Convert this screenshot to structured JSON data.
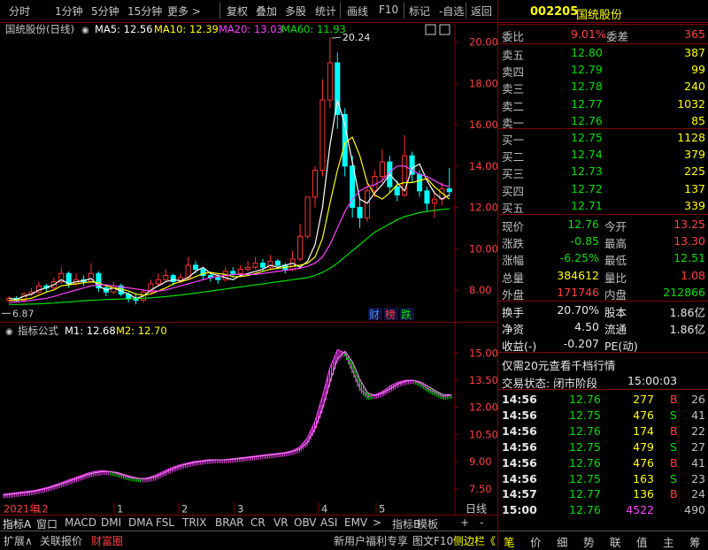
{
  "toolbar": {
    "left_items": [
      "分时",
      "1分钟",
      "5分钟",
      "15分钟",
      "更多 >"
    ],
    "right_items": [
      "复权",
      "叠加",
      "多股",
      "统计",
      "画线",
      "F10",
      "标记",
      "-自选",
      "返回"
    ]
  },
  "main_chart": {
    "stock_label": "国统股份(日线)",
    "ma5_label": "MA5: 12.56",
    "ma10_label": "MA10: 12.39",
    "ma20_label": "MA20: 13.03",
    "ma60_label": "MA60: 11.93",
    "high_annotation": "20.24",
    "low_annotation": "6.87",
    "badges": [
      "财",
      "榜",
      "跌"
    ],
    "colors": {
      "ma5": "#ffffff",
      "ma10": "#ffff00",
      "ma20": "#ff40ff",
      "ma60": "#00e000",
      "up": "#ff3232",
      "down": "#00ffff",
      "axis": "#800000",
      "label": "#ff4040"
    }
  },
  "sub_chart": {
    "title": "指标公式",
    "m1_label": "M1: 12.68",
    "m2_label": "M2: 12.70"
  },
  "x_axis": {
    "labels": [
      {
        "text": "2021年",
        "color": "#ff4040"
      },
      {
        "text": "12",
        "color": "#ff4040"
      },
      {
        "text": "1",
        "color": "#c8c8c8"
      },
      {
        "text": "2",
        "color": "#c8c8c8"
      },
      {
        "text": "3",
        "color": "#c8c8c8"
      },
      {
        "text": "4",
        "color": "#c8c8c8"
      },
      {
        "text": "5",
        "color": "#c8c8c8"
      }
    ],
    "period_label": "日线"
  },
  "chart_data": [
    {
      "type": "line",
      "title": "国统股份(日线)",
      "ylim": [
        6.5,
        20.8
      ],
      "yticks": [
        "8.00",
        "10.00",
        "12.00",
        "14.00",
        "16.00",
        "18.00",
        "20.00"
      ],
      "series": [
        {
          "name": "MA5",
          "color": "#ffffff",
          "values": [
            7.6,
            7.55,
            7.7,
            7.8,
            8.0,
            8.1,
            8.25,
            8.5,
            8.3,
            8.4,
            8.45,
            8.55,
            8.2,
            8.0,
            8.1,
            7.95,
            7.8,
            7.6,
            7.7,
            8.0,
            8.2,
            8.4,
            8.5,
            8.45,
            8.6,
            8.9,
            9.1,
            8.8,
            8.7,
            8.6,
            8.5,
            8.7,
            8.8,
            8.9,
            9.0,
            9.2,
            9.1,
            9.2,
            9.3,
            9.1,
            9.4,
            10.2,
            12.0,
            15.0,
            17.2,
            16.0,
            14.2,
            12.4,
            12.2,
            12.7,
            13.1,
            13.6,
            13.2,
            12.8,
            13.9,
            14.1,
            13.3,
            12.7,
            12.4,
            12.6
          ]
        },
        {
          "name": "MA10",
          "color": "#ffff00",
          "values": [
            7.5,
            7.5,
            7.55,
            7.6,
            7.75,
            7.9,
            8.0,
            8.2,
            8.25,
            8.3,
            8.35,
            8.4,
            8.35,
            8.2,
            8.1,
            8.05,
            7.95,
            7.8,
            7.75,
            7.8,
            7.95,
            8.1,
            8.3,
            8.4,
            8.5,
            8.65,
            8.8,
            8.85,
            8.8,
            8.75,
            8.65,
            8.65,
            8.7,
            8.8,
            8.9,
            9.0,
            9.05,
            9.1,
            9.15,
            9.2,
            9.3,
            9.6,
            10.5,
            12.2,
            13.8,
            15.1,
            15.4,
            14.5,
            13.2,
            12.6,
            12.4,
            12.7,
            13.1,
            13.2,
            13.2,
            13.3,
            13.4,
            13.0,
            12.7,
            12.4
          ]
        },
        {
          "name": "MA20",
          "color": "#ff40ff",
          "values": [
            7.4,
            7.42,
            7.45,
            7.5,
            7.55,
            7.6,
            7.68,
            7.8,
            7.9,
            8.0,
            8.1,
            8.2,
            8.25,
            8.25,
            8.2,
            8.15,
            8.1,
            8.05,
            8.0,
            7.95,
            7.95,
            8.0,
            8.1,
            8.2,
            8.3,
            8.4,
            8.5,
            8.6,
            8.65,
            8.7,
            8.75,
            8.75,
            8.75,
            8.75,
            8.8,
            8.85,
            8.9,
            8.95,
            9.0,
            9.05,
            9.15,
            9.3,
            9.6,
            10.2,
            11.0,
            11.8,
            12.4,
            12.8,
            13.0,
            13.1,
            13.3,
            13.7,
            14.0,
            14.0,
            13.8,
            13.6,
            13.5,
            13.3,
            13.1,
            13.0
          ]
        },
        {
          "name": "MA60",
          "color": "#00e000",
          "values": [
            7.3,
            7.3,
            7.31,
            7.32,
            7.33,
            7.35,
            7.37,
            7.4,
            7.42,
            7.45,
            7.48,
            7.5,
            7.52,
            7.54,
            7.55,
            7.56,
            7.57,
            7.58,
            7.6,
            7.62,
            7.65,
            7.68,
            7.72,
            7.76,
            7.8,
            7.85,
            7.9,
            7.95,
            8.0,
            8.05,
            8.1,
            8.15,
            8.2,
            8.25,
            8.3,
            8.35,
            8.4,
            8.45,
            8.5,
            8.55,
            8.6,
            8.7,
            8.85,
            9.05,
            9.3,
            9.6,
            9.9,
            10.2,
            10.5,
            10.8,
            11.0,
            11.2,
            11.4,
            11.55,
            11.65,
            11.75,
            11.8,
            11.85,
            11.9,
            11.93
          ]
        }
      ],
      "candles": [
        [
          7.5,
          7.6,
          7.7,
          7.4
        ],
        [
          7.6,
          7.5,
          7.7,
          7.4
        ],
        [
          7.5,
          7.8,
          7.9,
          7.4
        ],
        [
          7.8,
          7.9,
          8.1,
          7.7
        ],
        [
          7.9,
          8.2,
          8.4,
          7.8
        ],
        [
          8.2,
          8.1,
          8.3,
          7.9
        ],
        [
          8.1,
          8.4,
          8.6,
          8.0
        ],
        [
          8.4,
          8.8,
          9.1,
          8.3
        ],
        [
          8.8,
          8.3,
          8.9,
          8.1
        ],
        [
          8.3,
          8.5,
          8.8,
          8.2
        ],
        [
          8.5,
          8.4,
          8.7,
          8.2
        ],
        [
          8.4,
          8.8,
          9.3,
          8.3
        ],
        [
          8.8,
          8.1,
          8.9,
          7.9
        ],
        [
          8.1,
          7.9,
          8.2,
          7.7
        ],
        [
          7.9,
          8.2,
          8.4,
          7.8
        ],
        [
          8.2,
          7.8,
          8.3,
          7.7
        ],
        [
          7.8,
          7.6,
          7.9,
          7.4
        ],
        [
          7.6,
          7.5,
          7.8,
          7.3
        ],
        [
          7.5,
          7.9,
          8.0,
          7.4
        ],
        [
          7.9,
          8.3,
          8.5,
          7.8
        ],
        [
          8.3,
          8.5,
          8.8,
          8.2
        ],
        [
          8.5,
          8.7,
          9.0,
          8.4
        ],
        [
          8.7,
          8.4,
          8.8,
          8.2
        ],
        [
          8.4,
          8.6,
          8.8,
          8.3
        ],
        [
          8.6,
          9.2,
          9.6,
          8.5
        ],
        [
          9.2,
          9.0,
          9.4,
          8.8
        ],
        [
          9.0,
          8.7,
          9.1,
          8.5
        ],
        [
          8.7,
          8.6,
          8.9,
          8.4
        ],
        [
          8.6,
          8.5,
          8.8,
          8.3
        ],
        [
          8.5,
          8.9,
          9.1,
          8.4
        ],
        [
          8.9,
          8.8,
          9.1,
          8.6
        ],
        [
          8.8,
          9.0,
          9.2,
          8.7
        ],
        [
          9.0,
          9.1,
          9.4,
          8.9
        ],
        [
          9.1,
          9.3,
          9.6,
          9.0
        ],
        [
          9.3,
          9.1,
          9.5,
          8.9
        ],
        [
          9.1,
          9.4,
          9.7,
          9.0
        ],
        [
          9.4,
          9.2,
          9.5,
          9.0
        ],
        [
          9.2,
          9.0,
          9.3,
          8.8
        ],
        [
          9.0,
          9.5,
          9.9,
          8.9
        ],
        [
          9.5,
          10.6,
          11.2,
          9.4
        ],
        [
          10.6,
          12.5,
          12.5,
          10.5
        ],
        [
          12.5,
          13.8,
          14.0,
          12.0
        ],
        [
          13.8,
          17.2,
          18.2,
          13.5
        ],
        [
          17.2,
          19.0,
          20.24,
          16.8
        ],
        [
          19.0,
          16.5,
          19.5,
          15.8
        ],
        [
          16.5,
          14.0,
          16.8,
          13.5
        ],
        [
          14.0,
          12.0,
          14.5,
          11.5
        ],
        [
          12.0,
          11.5,
          12.5,
          11.0
        ],
        [
          11.5,
          12.8,
          13.2,
          11.3
        ],
        [
          12.8,
          13.5,
          13.8,
          12.5
        ],
        [
          13.5,
          14.2,
          14.8,
          13.2
        ],
        [
          14.2,
          13.0,
          14.5,
          12.7
        ],
        [
          13.0,
          12.6,
          13.3,
          12.3
        ],
        [
          12.6,
          14.5,
          15.5,
          12.5
        ],
        [
          14.5,
          13.6,
          14.7,
          13.2
        ],
        [
          13.6,
          12.8,
          13.8,
          12.5
        ],
        [
          12.8,
          12.2,
          13.0,
          11.8
        ],
        [
          12.2,
          12.4,
          12.8,
          11.5
        ],
        [
          12.4,
          12.9,
          13.2,
          12.1
        ],
        [
          12.9,
          12.76,
          13.9,
          12.51
        ]
      ]
    },
    {
      "type": "area",
      "title": "指标公式",
      "ylim": [
        7.0,
        15.8
      ],
      "yticks": [
        "7.50",
        "9.00",
        "10.50",
        "12.00",
        "13.50",
        "15.00"
      ],
      "series": [
        {
          "name": "M1",
          "values": [
            7.2,
            7.25,
            7.3,
            7.35,
            7.4,
            7.5,
            7.6,
            7.75,
            7.9,
            8.05,
            8.2,
            8.35,
            8.45,
            8.5,
            8.45,
            8.35,
            8.2,
            8.1,
            8.05,
            8.1,
            8.25,
            8.45,
            8.65,
            8.8,
            8.9,
            9.0,
            9.05,
            9.1,
            9.1,
            9.1,
            9.15,
            9.2,
            9.25,
            9.3,
            9.35,
            9.4,
            9.45,
            9.5,
            9.6,
            9.8,
            10.3,
            11.2,
            12.6,
            14.2,
            15.2,
            15.0,
            14.0,
            13.0,
            12.6,
            12.7,
            12.9,
            13.2,
            13.4,
            13.5,
            13.5,
            13.3,
            13.0,
            12.8,
            12.6,
            12.68
          ]
        },
        {
          "name": "M2",
          "values": [
            7.15,
            7.2,
            7.26,
            7.3,
            7.36,
            7.45,
            7.55,
            7.68,
            7.82,
            7.97,
            8.12,
            8.27,
            8.38,
            8.45,
            8.45,
            8.4,
            8.27,
            8.15,
            8.06,
            8.06,
            8.16,
            8.35,
            8.55,
            8.72,
            8.85,
            8.95,
            9.02,
            9.07,
            9.1,
            9.1,
            9.12,
            9.17,
            9.22,
            9.27,
            9.32,
            9.37,
            9.42,
            9.47,
            9.55,
            9.7,
            10.05,
            10.8,
            11.9,
            13.4,
            14.7,
            15.1,
            14.5,
            13.5,
            12.8,
            12.65,
            12.8,
            13.05,
            13.3,
            13.45,
            13.5,
            13.4,
            13.15,
            12.9,
            12.7,
            12.7
          ]
        }
      ]
    }
  ],
  "quote": {
    "code": "002205",
    "name": "国统股份",
    "weibi_label": "委比",
    "weibi_value": "9.01%",
    "weicha_label": "委差",
    "weicha_value": "365",
    "sell": [
      {
        "label": "卖五",
        "price": "12.80",
        "vol": "387"
      },
      {
        "label": "卖四",
        "price": "12.79",
        "vol": "99"
      },
      {
        "label": "卖三",
        "price": "12.78",
        "vol": "240"
      },
      {
        "label": "卖二",
        "price": "12.77",
        "vol": "1032"
      },
      {
        "label": "卖一",
        "price": "12.76",
        "vol": "85"
      }
    ],
    "buy": [
      {
        "label": "买一",
        "price": "12.75",
        "vol": "1128"
      },
      {
        "label": "买二",
        "price": "12.74",
        "vol": "379"
      },
      {
        "label": "买三",
        "price": "12.73",
        "vol": "225"
      },
      {
        "label": "买四",
        "price": "12.72",
        "vol": "137"
      },
      {
        "label": "买五",
        "price": "12.71",
        "vol": "339"
      }
    ],
    "stats": [
      {
        "l1": "现价",
        "v1": "12.76",
        "c1": "green",
        "l2": "今开",
        "v2": "13.25",
        "c2": "red"
      },
      {
        "l1": "涨跌",
        "v1": "-0.85",
        "c1": "green",
        "l2": "最高",
        "v2": "13.30",
        "c2": "red"
      },
      {
        "l1": "涨幅",
        "v1": "-6.25%",
        "c1": "green",
        "l2": "最低",
        "v2": "12.51",
        "c2": "green"
      },
      {
        "l1": "总量",
        "v1": "384612",
        "c1": "yellow",
        "l2": "量比",
        "v2": "1.08",
        "c2": "red"
      },
      {
        "l1": "外盘",
        "v1": "171746",
        "c1": "red",
        "l2": "内盘",
        "v2": "212866",
        "c2": "green"
      }
    ],
    "stats2": [
      {
        "l1": "换手",
        "v1": "20.70%",
        "l2": "股本",
        "v2": "1.86亿"
      },
      {
        "l1": "净资",
        "v1": "4.50",
        "l2": "流通",
        "v2": "1.86亿"
      },
      {
        "l1": "收益(-)",
        "v1": "-0.207",
        "l2": "PE(动)",
        "v2": ""
      }
    ],
    "promo": "仅需20元查看千档行情",
    "status_label": "交易状态: 闭市阶段",
    "status_time": "15:00:03"
  },
  "ticks": [
    {
      "time": "14:56",
      "price": "12.76",
      "vol": "277",
      "bs": "B",
      "n": "26"
    },
    {
      "time": "14:56",
      "price": "12.75",
      "vol": "476",
      "bs": "S",
      "n": "41"
    },
    {
      "time": "14:56",
      "price": "12.76",
      "vol": "174",
      "bs": "B",
      "n": "22"
    },
    {
      "time": "14:56",
      "price": "12.75",
      "vol": "479",
      "bs": "S",
      "n": "27"
    },
    {
      "time": "14:56",
      "price": "12.76",
      "vol": "476",
      "bs": "B",
      "n": "41"
    },
    {
      "time": "14:56",
      "price": "12.75",
      "vol": "163",
      "bs": "S",
      "n": "23"
    },
    {
      "time": "14:57",
      "price": "12.77",
      "vol": "136",
      "bs": "B",
      "n": "24"
    },
    {
      "time": "15:00",
      "price": "12.76",
      "vol": "4522",
      "bs": "",
      "n": "490"
    }
  ],
  "bottom_tabs1": [
    "指标A",
    "窗口",
    "MACD",
    "DMI",
    "DMA",
    "FSL",
    "TRIX",
    "BRAR",
    "CR",
    "VR",
    "OBV",
    "ASI",
    "EMV",
    ">",
    "指标B",
    "模板",
    "+",
    "-"
  ],
  "bottom_tabs2": [
    "扩展∧",
    "关联报价",
    "财富圈"
  ],
  "bottom_right": [
    "新用户福利专享",
    "图文F10",
    "侧边栏《"
  ],
  "right_tabs": [
    "笔",
    "价",
    "细",
    "势",
    "联",
    "值",
    "主",
    "筹"
  ]
}
